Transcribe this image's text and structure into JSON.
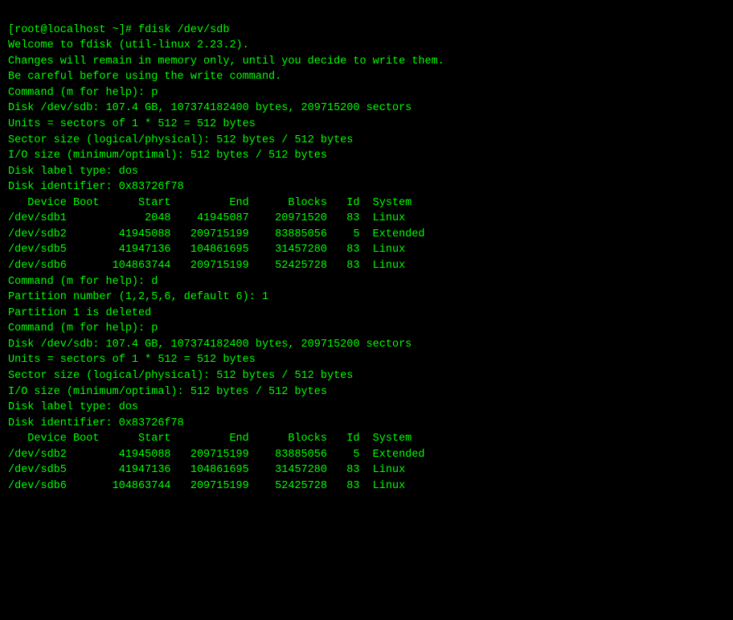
{
  "terminal": {
    "lines": [
      {
        "type": "prompt",
        "text": "[root@localhost ~]# fdisk /dev/sdb"
      },
      {
        "type": "output",
        "text": "Welcome to fdisk (util-linux 2.23.2)."
      },
      {
        "type": "blank",
        "text": ""
      },
      {
        "type": "output",
        "text": "Changes will remain in memory only, until you decide to write them."
      },
      {
        "type": "output",
        "text": "Be careful before using the write command."
      },
      {
        "type": "blank",
        "text": ""
      },
      {
        "type": "blank",
        "text": ""
      },
      {
        "type": "output",
        "text": "Command (m for help): p"
      },
      {
        "type": "blank",
        "text": ""
      },
      {
        "type": "output",
        "text": "Disk /dev/sdb: 107.4 GB, 107374182400 bytes, 209715200 sectors"
      },
      {
        "type": "output",
        "text": "Units = sectors of 1 * 512 = 512 bytes"
      },
      {
        "type": "output",
        "text": "Sector size (logical/physical): 512 bytes / 512 bytes"
      },
      {
        "type": "output",
        "text": "I/O size (minimum/optimal): 512 bytes / 512 bytes"
      },
      {
        "type": "output",
        "text": "Disk label type: dos"
      },
      {
        "type": "output",
        "text": "Disk identifier: 0x83726f78"
      },
      {
        "type": "blank",
        "text": ""
      },
      {
        "type": "output",
        "text": "   Device Boot      Start         End      Blocks   Id  System"
      },
      {
        "type": "output",
        "text": "/dev/sdb1            2048    41945087    20971520   83  Linux"
      },
      {
        "type": "output",
        "text": "/dev/sdb2        41945088   209715199    83885056    5  Extended"
      },
      {
        "type": "output",
        "text": "/dev/sdb5        41947136   104861695    31457280   83  Linux"
      },
      {
        "type": "output",
        "text": "/dev/sdb6       104863744   209715199    52425728   83  Linux"
      },
      {
        "type": "blank",
        "text": ""
      },
      {
        "type": "output",
        "text": "Command (m for help): d"
      },
      {
        "type": "output",
        "text": "Partition number (1,2,5,6, default 6): 1"
      },
      {
        "type": "output",
        "text": "Partition 1 is deleted"
      },
      {
        "type": "blank",
        "text": ""
      },
      {
        "type": "output",
        "text": "Command (m for help): p"
      },
      {
        "type": "blank",
        "text": ""
      },
      {
        "type": "output",
        "text": "Disk /dev/sdb: 107.4 GB, 107374182400 bytes, 209715200 sectors"
      },
      {
        "type": "output",
        "text": "Units = sectors of 1 * 512 = 512 bytes"
      },
      {
        "type": "output",
        "text": "Sector size (logical/physical): 512 bytes / 512 bytes"
      },
      {
        "type": "output",
        "text": "I/O size (minimum/optimal): 512 bytes / 512 bytes"
      },
      {
        "type": "output",
        "text": "Disk label type: dos"
      },
      {
        "type": "output",
        "text": "Disk identifier: 0x83726f78"
      },
      {
        "type": "blank",
        "text": ""
      },
      {
        "type": "output",
        "text": "   Device Boot      Start         End      Blocks   Id  System"
      },
      {
        "type": "output",
        "text": "/dev/sdb2        41945088   209715199    83885056    5  Extended"
      },
      {
        "type": "output",
        "text": "/dev/sdb5        41947136   104861695    31457280   83  Linux"
      },
      {
        "type": "output",
        "text": "/dev/sdb6       104863744   209715199    52425728   83  Linux"
      }
    ]
  }
}
